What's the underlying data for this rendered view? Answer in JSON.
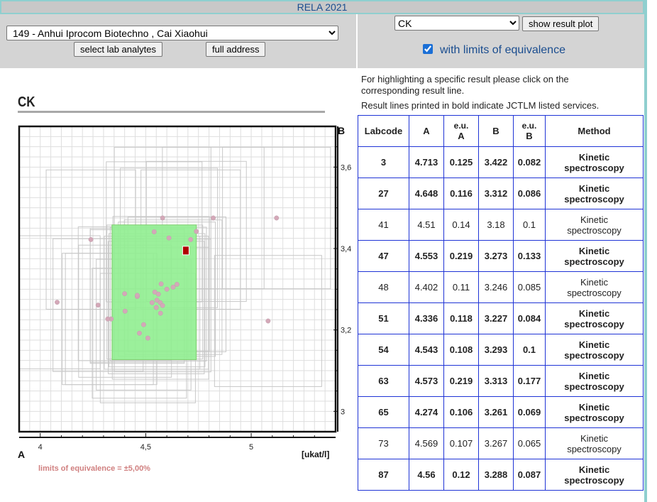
{
  "header": {
    "title": "RELA 2021"
  },
  "lab_selector": {
    "selected": "149 - Anhui Iprocom Biotechno , Cai Xiaohui",
    "select_analytes_label": "select lab analytes",
    "full_address_label": "full address"
  },
  "analyte_selector": {
    "selected": "CK",
    "show_plot_label": "show result plot",
    "limits_checkbox_label": "with limits of equivalence",
    "limits_checked": true
  },
  "info": {
    "line1": "For highlighting a specific result please click on the",
    "line2": "corresponding result line.",
    "line3": "Result lines printed in bold indicate JCTLM listed services."
  },
  "chart_data": {
    "type": "scatter",
    "title": "CK",
    "xlabel": "A",
    "ylabel": "B",
    "unit_label": "[ukat/l]",
    "x_ticks": [
      "4",
      "4,5",
      "5"
    ],
    "y_ticks": [
      "3",
      "3,2",
      "3,4",
      "3,6"
    ],
    "xlim": [
      3.9,
      5.4
    ],
    "ylim": [
      2.95,
      3.7
    ],
    "grid": true,
    "limits_note": "limits of equivalence = ±5,00%",
    "highlight_box": {
      "x": [
        4.34,
        4.74
      ],
      "y": [
        3.127,
        3.458
      ]
    },
    "highlight_point": {
      "x": 4.69,
      "y": 3.395
    },
    "points": [
      {
        "x": 4.713,
        "y": 3.422
      },
      {
        "x": 4.648,
        "y": 3.312
      },
      {
        "x": 4.51,
        "y": 3.18
      },
      {
        "x": 4.553,
        "y": 3.273
      },
      {
        "x": 4.402,
        "y": 3.246
      },
      {
        "x": 4.336,
        "y": 3.227
      },
      {
        "x": 4.543,
        "y": 3.293
      },
      {
        "x": 4.573,
        "y": 3.313
      },
      {
        "x": 4.274,
        "y": 3.261
      },
      {
        "x": 4.569,
        "y": 3.267
      },
      {
        "x": 4.56,
        "y": 3.288
      },
      {
        "x": 4.08,
        "y": 3.268
      },
      {
        "x": 4.32,
        "y": 3.227
      },
      {
        "x": 4.4,
        "y": 3.289
      },
      {
        "x": 4.46,
        "y": 3.282
      },
      {
        "x": 4.53,
        "y": 3.267
      },
      {
        "x": 4.55,
        "y": 3.255
      },
      {
        "x": 4.58,
        "y": 3.26
      },
      {
        "x": 4.63,
        "y": 3.305
      },
      {
        "x": 4.6,
        "y": 3.3
      },
      {
        "x": 4.49,
        "y": 3.213
      },
      {
        "x": 4.47,
        "y": 3.192
      },
      {
        "x": 4.57,
        "y": 3.241
      },
      {
        "x": 4.24,
        "y": 3.422
      },
      {
        "x": 4.54,
        "y": 3.441
      },
      {
        "x": 4.61,
        "y": 3.426
      },
      {
        "x": 4.74,
        "y": 3.442
      },
      {
        "x": 4.58,
        "y": 3.475
      },
      {
        "x": 4.82,
        "y": 3.475
      },
      {
        "x": 5.12,
        "y": 3.475
      },
      {
        "x": 5.08,
        "y": 3.222
      },
      {
        "x": 4.46,
        "y": 3.285
      }
    ]
  },
  "table": {
    "headers": [
      {
        "l1": "Labcode",
        "l2": ""
      },
      {
        "l1": "A",
        "l2": ""
      },
      {
        "l1": "e.u.",
        "l2": "A"
      },
      {
        "l1": "B",
        "l2": ""
      },
      {
        "l1": "e.u.",
        "l2": "B"
      },
      {
        "l1": "Method",
        "l2": ""
      }
    ],
    "rows": [
      {
        "labcode": "3",
        "a": "4.713",
        "eua": "0.125",
        "b": "3.422",
        "eub": "0.082",
        "m1": "Kinetic",
        "m2": "spectroscopy",
        "bold": true
      },
      {
        "labcode": "27",
        "a": "4.648",
        "eua": "0.116",
        "b": "3.312",
        "eub": "0.086",
        "m1": "Kinetic",
        "m2": "spectroscopy",
        "bold": true
      },
      {
        "labcode": "41",
        "a": "4.51",
        "eua": "0.14",
        "b": "3.18",
        "eub": "0.1",
        "m1": "Kinetic",
        "m2": "spectroscopy",
        "bold": false
      },
      {
        "labcode": "47",
        "a": "4.553",
        "eua": "0.219",
        "b": "3.273",
        "eub": "0.133",
        "m1": "Kinetic",
        "m2": "spectroscopy",
        "bold": true
      },
      {
        "labcode": "48",
        "a": "4.402",
        "eua": "0.11",
        "b": "3.246",
        "eub": "0.085",
        "m1": "Kinetic",
        "m2": "spectroscopy",
        "bold": false
      },
      {
        "labcode": "51",
        "a": "4.336",
        "eua": "0.118",
        "b": "3.227",
        "eub": "0.084",
        "m1": "Kinetic",
        "m2": "spectroscopy",
        "bold": true
      },
      {
        "labcode": "54",
        "a": "4.543",
        "eua": "0.108",
        "b": "3.293",
        "eub": "0.1",
        "m1": "Kinetic",
        "m2": "spectroscopy",
        "bold": true
      },
      {
        "labcode": "63",
        "a": "4.573",
        "eua": "0.219",
        "b": "3.313",
        "eub": "0.177",
        "m1": "Kinetic",
        "m2": "spectroscopy",
        "bold": true
      },
      {
        "labcode": "65",
        "a": "4.274",
        "eua": "0.106",
        "b": "3.261",
        "eub": "0.069",
        "m1": "Kinetic",
        "m2": "spectroscopy",
        "bold": true
      },
      {
        "labcode": "73",
        "a": "4.569",
        "eua": "0.107",
        "b": "3.267",
        "eub": "0.065",
        "m1": "Kinetic",
        "m2": "spectroscopy",
        "bold": false
      },
      {
        "labcode": "87",
        "a": "4.56",
        "eua": "0.12",
        "b": "3.288",
        "eub": "0.087",
        "m1": "Kinetic",
        "m2": "spectroscopy",
        "bold": true
      }
    ]
  }
}
